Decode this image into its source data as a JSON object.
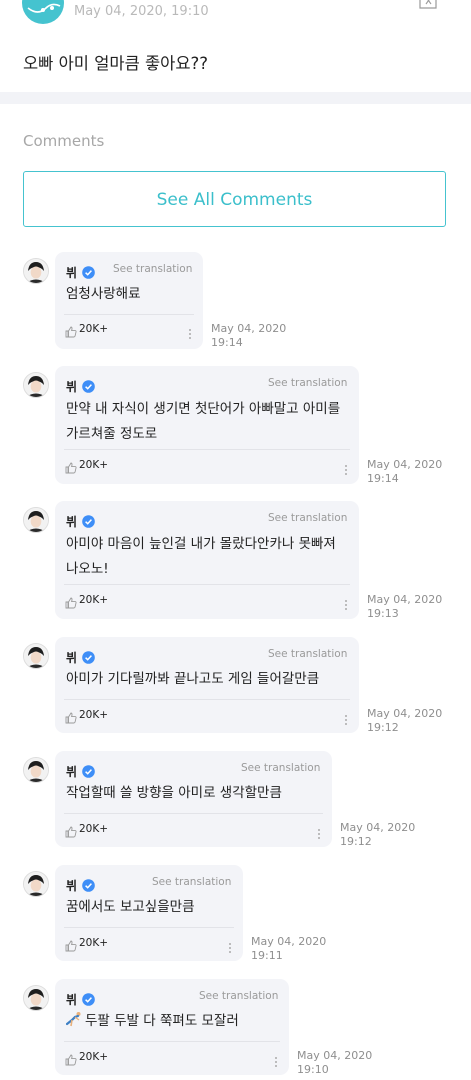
{
  "post": {
    "date": "May 04, 2020, 19:10",
    "text": "오빠 아미 얼마큼 좋아요??"
  },
  "comments_section": {
    "title": "Comments",
    "see_all": "See All Comments"
  },
  "comments": [
    {
      "author": "뷔",
      "see_translation": "See translation",
      "text": "엄청사랑해료",
      "likes": "20K+",
      "date": "May 04, 2020",
      "time": "19:14"
    },
    {
      "author": "뷔",
      "see_translation": "See translation",
      "text_lines": [
        "만약 내 자식이 생기면 첫단어가 아빠말고 아미를",
        "가르쳐줄 정도로"
      ],
      "likes": "20K+",
      "date": "May 04, 2020",
      "time": "19:14"
    },
    {
      "author": "뷔",
      "see_translation": "See translation",
      "text_lines": [
        "아미야 마음이 늪인걸 내가 몰랐다안카나 못빠져",
        "나오노!"
      ],
      "likes": "20K+",
      "date": "May 04, 2020",
      "time": "19:13"
    },
    {
      "author": "뷔",
      "see_translation": "See translation",
      "text": "아미가 기다릴까봐 끝나고도 게임 들어갈만큼",
      "likes": "20K+",
      "date": "May 04, 2020",
      "time": "19:12"
    },
    {
      "author": "뷔",
      "see_translation": "See translation",
      "text": "작업할때 쓸 방향을 아미로 생각할만큼",
      "likes": "20K+",
      "date": "May 04, 2020",
      "time": "19:12"
    },
    {
      "author": "뷔",
      "see_translation": "See translation",
      "text": "꿈에서도 보고싶을만큼",
      "likes": "20K+",
      "date": "May 04, 2020",
      "time": "19:11"
    },
    {
      "author": "뷔",
      "see_translation": "See translation",
      "text": "두팔 두발 다 쭉펴도 모잘러",
      "likes": "20K+",
      "date": "May 04, 2020",
      "time": "19:10"
    }
  ],
  "colors": {
    "accent": "#45c3cf",
    "badge": "#3e8ef7",
    "bubble": "#f3f4f8"
  },
  "icons": [
    "app-logo-icon",
    "translate-icon",
    "verified-badge-icon",
    "like-icon",
    "more-icon",
    "gymnast-emoji-icon"
  ]
}
